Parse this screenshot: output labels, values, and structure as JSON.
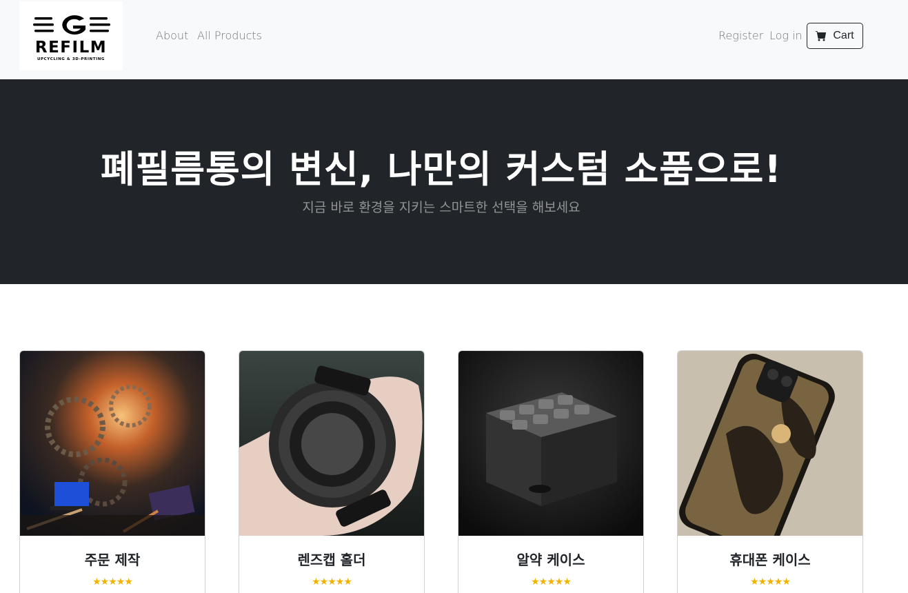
{
  "navbar": {
    "brand": {
      "name": "REFILM",
      "tagline": "UPCYCLING & 3D-PRINTING"
    },
    "links": {
      "about": "About",
      "all_products": "All Products",
      "register": "Register",
      "login": "Log in"
    },
    "cart": {
      "label": "Cart",
      "icon": "cart-icon"
    }
  },
  "hero": {
    "title": "폐필름통의 변신, 나만의 커스텀 소품으로!",
    "subtitle": "지금 바로 환경을 지키는 스마트한 선택을 해보세요"
  },
  "products": [
    {
      "name": "주문 제작",
      "stars": "★★★★★",
      "rating": 5
    },
    {
      "name": "렌즈캡 홀더",
      "stars": "★★★★★",
      "rating": 5
    },
    {
      "name": "알약 케이스",
      "stars": "★★★★★",
      "rating": 5
    },
    {
      "name": "휴대폰 케이스",
      "stars": "★★★★★",
      "rating": 5
    }
  ],
  "colors": {
    "navbar_bg": "#f8f9fa",
    "hero_bg": "#212529",
    "star": "#f0b400"
  }
}
